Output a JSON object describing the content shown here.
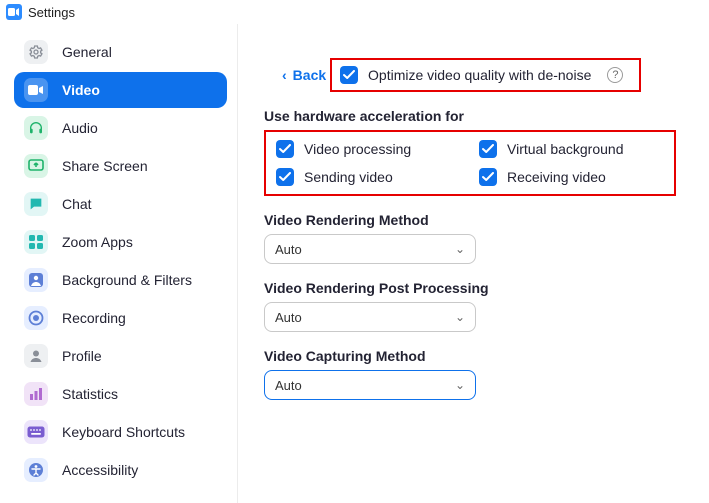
{
  "titlebar": {
    "title": "Settings"
  },
  "sidebar": {
    "items": [
      {
        "label": "General"
      },
      {
        "label": "Video"
      },
      {
        "label": "Audio"
      },
      {
        "label": "Share Screen"
      },
      {
        "label": "Chat"
      },
      {
        "label": "Zoom Apps"
      },
      {
        "label": "Background & Filters"
      },
      {
        "label": "Recording"
      },
      {
        "label": "Profile"
      },
      {
        "label": "Statistics"
      },
      {
        "label": "Keyboard Shortcuts"
      },
      {
        "label": "Accessibility"
      }
    ]
  },
  "content": {
    "back_label": "Back",
    "optimize_label": "Optimize video quality with de-noise",
    "hw_heading": "Use hardware acceleration for",
    "hw": {
      "video_processing": "Video processing",
      "virtual_background": "Virtual background",
      "sending_video": "Sending video",
      "receiving_video": "Receiving video"
    },
    "render_method_heading": "Video Rendering Method",
    "render_method_value": "Auto",
    "render_post_heading": "Video Rendering Post Processing",
    "render_post_value": "Auto",
    "capture_heading": "Video Capturing Method",
    "capture_value": "Auto"
  }
}
